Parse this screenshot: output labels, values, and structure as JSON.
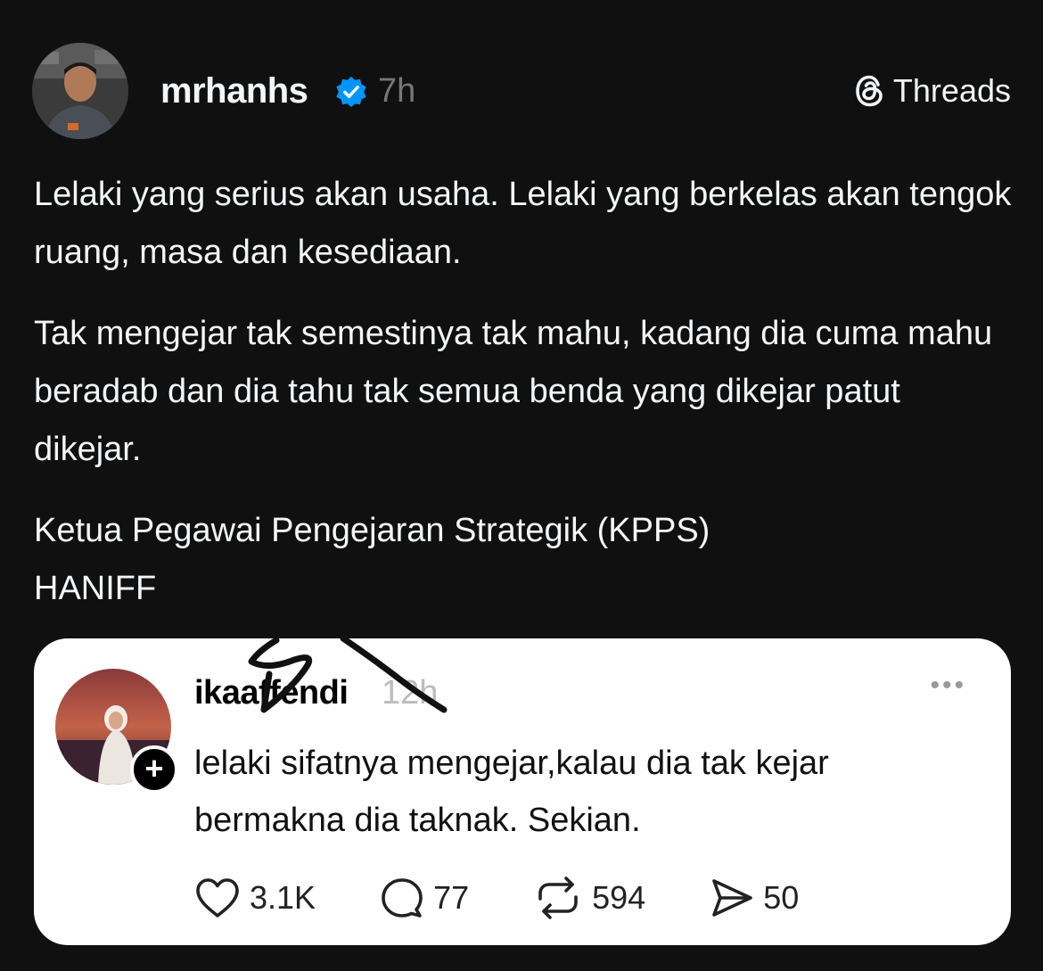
{
  "post": {
    "username": "mrhanhs",
    "verified_icon": "verified-badge-icon",
    "timestamp": "7h",
    "brand_label": "Threads",
    "paragraphs": [
      "Lelaki yang serius akan usaha. Lelaki yang berkelas akan tengok ruang, masa dan kesediaan.",
      "Tak mengejar tak semestinya tak mahu, kadang dia cuma mahu beradab dan dia tahu tak semua benda yang dikejar patut dikejar.",
      "Ketua Pegawai Pengejaran Strategik (KPPS)\nHANIFF"
    ]
  },
  "quoted": {
    "username": "ikaaffendi",
    "timestamp": "12h",
    "more_label": "•••",
    "text": "lelaki sifatnya mengejar,kalau dia tak kejar bermakna dia taknak. Sekian.",
    "follow_label": "+",
    "actions": {
      "likes": "3.1K",
      "comments": "77",
      "reposts": "594",
      "shares": "50"
    }
  },
  "colors": {
    "background": "#101010",
    "text": "#f3f5f7",
    "muted": "#777777",
    "verified": "#0095f6",
    "card": "#ffffff"
  }
}
